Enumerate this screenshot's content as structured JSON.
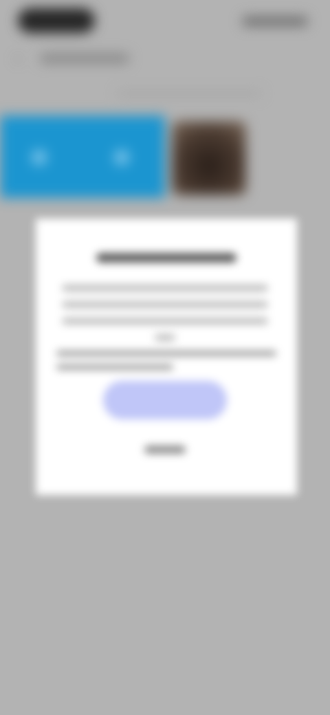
{
  "colors": {
    "background": "#b3b3b3",
    "banner": "#1b95d0",
    "dialog": "#ffffff",
    "primary_button": "#c0c6f8"
  },
  "status_bar": {
    "time": "",
    "icons": ""
  },
  "header": {
    "back_icon": "chevron-left-icon",
    "back_label": ""
  },
  "content": {
    "caption": ""
  },
  "dialog": {
    "title": "",
    "body_lines": [
      "",
      "",
      "",
      ""
    ],
    "note_lines": [
      "",
      ""
    ],
    "primary_button_label": "",
    "secondary_button_label": ""
  }
}
